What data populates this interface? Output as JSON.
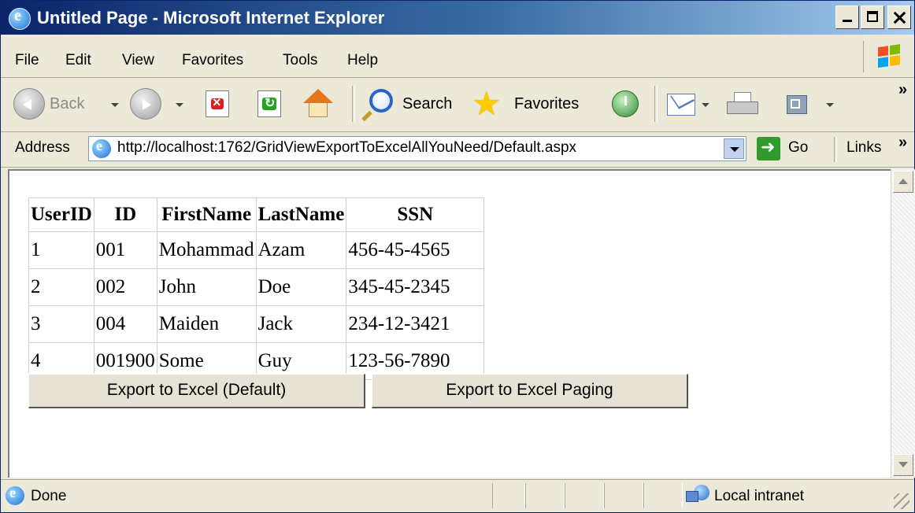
{
  "window": {
    "title": "Untitled Page - Microsoft Internet Explorer"
  },
  "menu": {
    "items": [
      "File",
      "Edit",
      "View",
      "Favorites",
      "Tools",
      "Help"
    ]
  },
  "toolbar": {
    "back_label": "Back",
    "search_label": "Search",
    "favorites_label": "Favorites",
    "overflow": "»"
  },
  "addressbar": {
    "label": "Address",
    "url": "http://localhost:1762/GridViewExportToExcelAllYouNeed/Default.aspx",
    "go_label": "Go",
    "links_label": "Links",
    "overflow": "»"
  },
  "grid": {
    "columns": [
      "UserID",
      "ID",
      "FirstName",
      "LastName",
      "SSN"
    ],
    "rows": [
      [
        "1",
        "001",
        "Mohammad",
        "Azam",
        "456-45-4565"
      ],
      [
        "2",
        "002",
        "John",
        "Doe",
        "345-45-2345"
      ],
      [
        "3",
        "004",
        "Maiden",
        "Jack",
        "234-12-3421"
      ],
      [
        "4",
        "001900",
        "Some",
        "Guy",
        "123-56-7890"
      ]
    ]
  },
  "buttons": {
    "export_default": "Export to Excel (Default)",
    "export_paging": "Export to Excel Paging"
  },
  "status": {
    "text": "Done",
    "zone": "Local intranet"
  }
}
